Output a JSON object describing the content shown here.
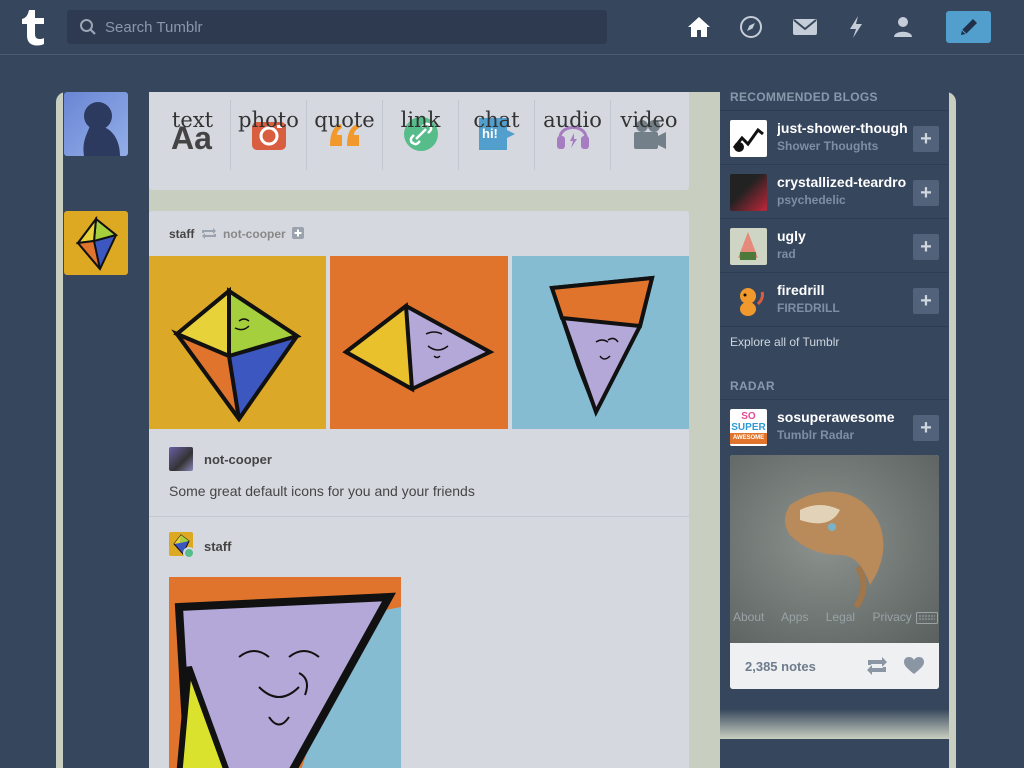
{
  "header": {
    "search_placeholder": "Search Tumblr",
    "nav": [
      "home-icon",
      "explore-icon",
      "inbox-icon",
      "activity-icon",
      "account-icon"
    ],
    "compose": "pencil-icon"
  },
  "post_types": [
    {
      "label": "text",
      "glyph": "Aa",
      "color": "#444444"
    },
    {
      "label": "photo",
      "color": "#d95e40"
    },
    {
      "label": "quote",
      "color": "#f2992e"
    },
    {
      "label": "link",
      "color": "#56bc8a"
    },
    {
      "label": "chat",
      "glyph": "hi!",
      "color": "#529ecc"
    },
    {
      "label": "audio",
      "color": "#a77dc2"
    },
    {
      "label": "video",
      "color": "#748089"
    }
  ],
  "post": {
    "author": "staff",
    "reblogged_from": "not-cooper",
    "source_user": "not-cooper",
    "caption": "Some great default icons for you and your friends",
    "reblogger": "staff"
  },
  "sidebar": {
    "recommended_title": "RECOMMENDED BLOGS",
    "blogs": [
      {
        "name": "just-shower-thoughts",
        "sub": "Shower Thoughts"
      },
      {
        "name": "crystallized-teardrops",
        "sub": "psychedelic"
      },
      {
        "name": "ugly",
        "sub": "rad"
      },
      {
        "name": "firedrill",
        "sub": "FIREDRILL"
      }
    ],
    "explore": "Explore all of Tumblr",
    "radar_title": "RADAR",
    "radar": {
      "name": "sosuperawesome",
      "sub": "Tumblr Radar",
      "avatar_text": [
        "SO",
        "SUPER",
        "AWESOME"
      ]
    },
    "notes": "2,385 notes",
    "footer_links": [
      "About",
      "Apps",
      "Legal",
      "Privacy"
    ]
  }
}
